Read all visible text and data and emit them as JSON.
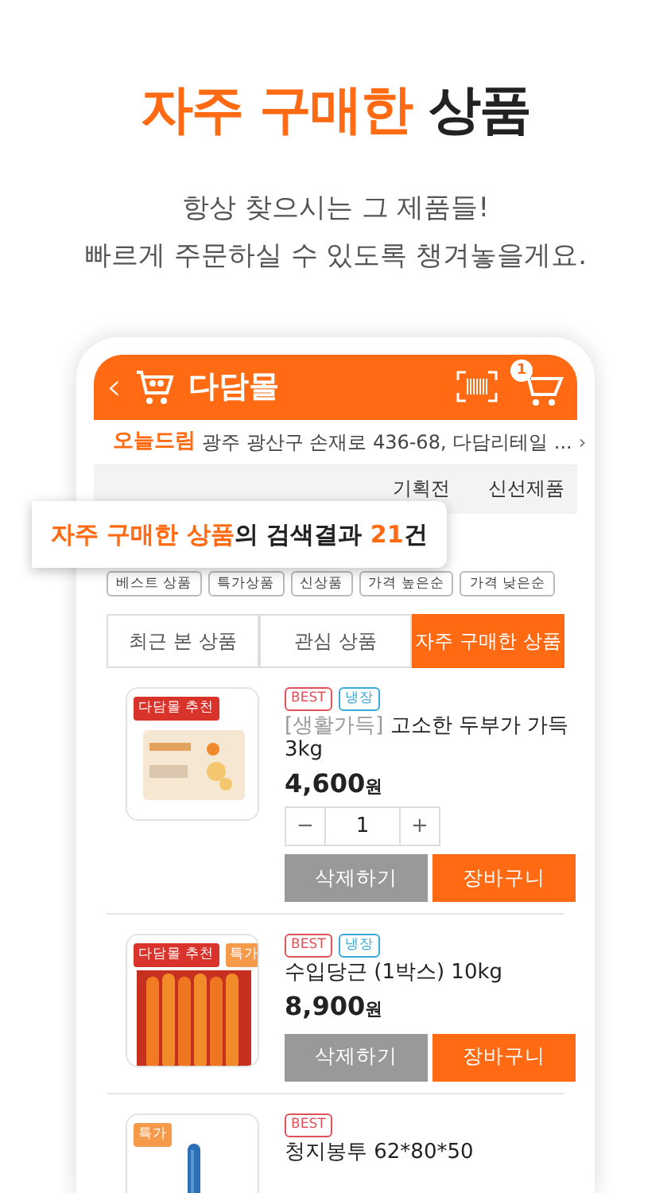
{
  "headline": [
    {
      "text": "자주 구매한",
      "highlight": true
    },
    {
      "text": " 상품",
      "highlight": false
    }
  ],
  "subtitle": [
    "항상 찾으시는 그 제품들!",
    "빠르게 주문하실 수 있도록 챙겨놓을게요."
  ],
  "app_header": {
    "back": "‹",
    "title": "다담몰",
    "cart_count": "1"
  },
  "address": {
    "store": "오늘드림",
    "text": "광주 광산구 손재로 436-68, 다담리테일 ...",
    "chevron": "›"
  },
  "category_tabs": [
    "기획전",
    "신선제품"
  ],
  "callout": [
    {
      "text": "자주 구매한 상품",
      "highlight": true
    },
    {
      "text": "의 검색결과 ",
      "highlight": false
    },
    {
      "text": "21",
      "highlight": true
    },
    {
      "text": "건",
      "highlight": false
    }
  ],
  "filter_chips": [
    "베스트 상품",
    "특가상품",
    "신상품",
    "가격 높은순",
    "가격 낮은순"
  ],
  "segments": [
    {
      "label": "최근 본 상품",
      "selected": false
    },
    {
      "label": "관심 상품",
      "selected": false
    },
    {
      "label": "자주 구매한 상품",
      "selected": true
    }
  ],
  "products": [
    {
      "badges": [
        {
          "text": "다담몰 추천",
          "color": "#d9342b"
        }
      ],
      "tags": [
        {
          "text": "BEST",
          "color": "#e0525a"
        },
        {
          "text": "냉장",
          "color": "#3aa8d8"
        }
      ],
      "brand": "[생활가득]",
      "name": "고소한 두부가 가득 3kg",
      "price": "4,600",
      "unit": "원",
      "quantity": "1",
      "minus": "−",
      "plus": "+",
      "delete": "삭제하기",
      "cart": "장바구니"
    },
    {
      "badges": [
        {
          "text": "다담몰 추천",
          "color": "#d9342b"
        },
        {
          "text": "특가",
          "color": "#f59a4a"
        }
      ],
      "tags": [
        {
          "text": "BEST",
          "color": "#e0525a"
        },
        {
          "text": "냉장",
          "color": "#3aa8d8"
        }
      ],
      "name": "수입당근 (1박스) 10kg",
      "price": "8,900",
      "unit": "원",
      "delete": "삭제하기",
      "cart": "장바구니"
    },
    {
      "badges": [
        {
          "text": "특가",
          "color": "#f59a4a"
        }
      ],
      "tags": [
        {
          "text": "BEST",
          "color": "#e0525a"
        }
      ],
      "name": "청지봉투 62*80*50"
    }
  ]
}
